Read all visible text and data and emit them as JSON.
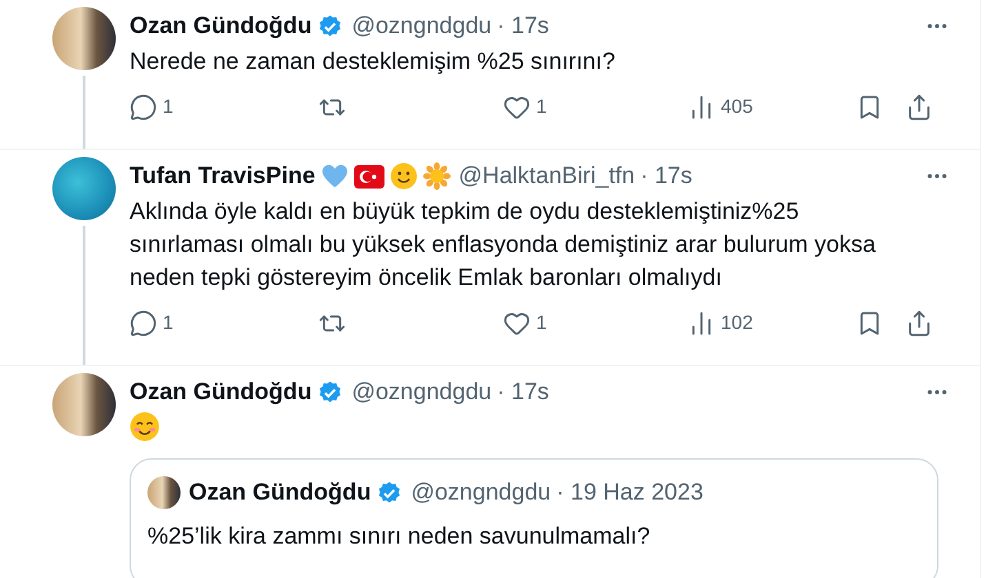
{
  "tweets": [
    {
      "author": "Ozan Gündoğdu",
      "verified": true,
      "handle": "@ozngndgdu",
      "time": "· 17s",
      "text": "Nerede ne zaman desteklemişim %25 sınırını?",
      "replies": "1",
      "likes": "1",
      "views": "405",
      "avatar": {
        "kind": "photo"
      }
    },
    {
      "author": "Tufan TravisPine",
      "badges": [
        {
          "kind": "heart"
        },
        {
          "kind": "flag"
        },
        {
          "kind": "smile"
        },
        {
          "kind": "sun"
        }
      ],
      "handle": "@HalktanBiri_tfn",
      "time": "· 17s",
      "text": "Aklında öyle kaldı en büyük tepkim de oydu desteklemiştiniz%25\nsınırlaması olmalı bu yüksek enflasyonda demiştiniz arar bulurum yoksa neden tepki göstereyim öncelik Emlak baronları olmalıydı",
      "replies": "1",
      "likes": "1",
      "views": "102",
      "avatar": {
        "kind": "sea"
      }
    },
    {
      "author": "Ozan Gündoğdu",
      "verified": true,
      "handle": "@ozngndgdu",
      "time": "· 17s",
      "body_emoji": true,
      "avatar": {
        "kind": "photo"
      },
      "quote": {
        "author": "Ozan Gündoğdu",
        "verified": true,
        "handle": "@ozngndgdu",
        "time": "· 19 Haz 2023",
        "text": "%25’lik kira zammı sınırı neden savunulmamalı?"
      }
    }
  ]
}
